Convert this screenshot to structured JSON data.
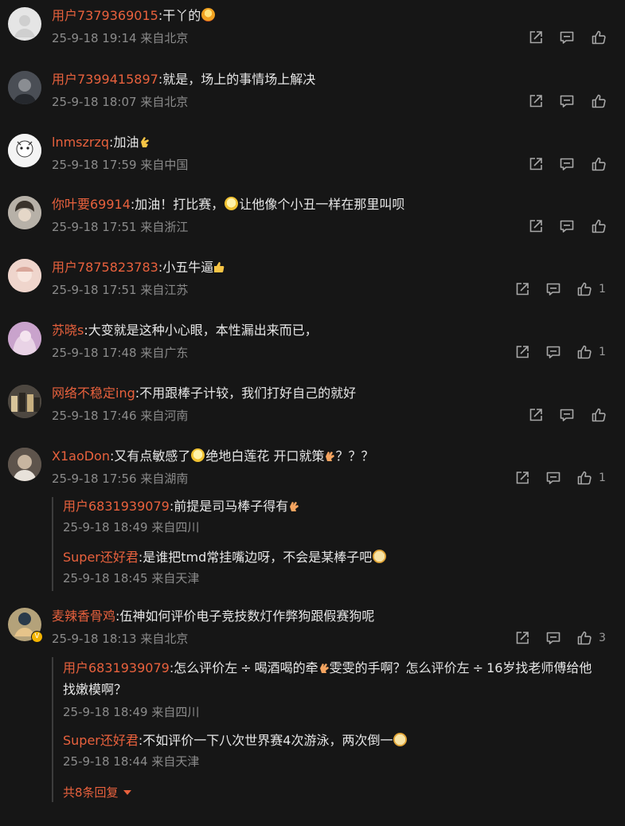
{
  "comments": [
    {
      "user": "用户7379369015",
      "text": ":干丫的",
      "emoji": "fire-face",
      "date": "25-9-18 19:14",
      "location": "来自北京",
      "likes": "",
      "avatar_color": "#e5e5e5"
    },
    {
      "user": "用户7399415897",
      "text": ":就是，场上的事情场上解决",
      "date": "25-9-18 18:07",
      "location": "来自北京",
      "likes": "",
      "avatar_color": "#5a6068"
    },
    {
      "user": "lnmszrzq",
      "text": ":加油",
      "emoji": "clap",
      "date": "25-9-18 17:59",
      "location": "来自中国",
      "likes": "",
      "avatar_color": "#f2f2f2"
    },
    {
      "user": "你叶要69914",
      "text_before": ":加油！打比赛，",
      "emoji": "laugh-cry",
      "text_after": "让他像个小丑一样在那里叫呗",
      "date": "25-9-18 17:51",
      "location": "来自浙江",
      "likes": "",
      "avatar_color": "#a8a29a"
    },
    {
      "user": "用户7875823783",
      "text": ":小五牛逼",
      "emoji": "thumbs-up",
      "date": "25-9-18 17:51",
      "location": "来自江苏",
      "likes": "1",
      "avatar_color": "#e8c8c0"
    },
    {
      "user": "苏晓s",
      "text": ":大变就是这种小心眼，本性漏出来而已，",
      "date": "25-9-18 17:48",
      "location": "来自广东",
      "likes": "1",
      "avatar_color": "#c59ac8"
    },
    {
      "user": "网络不稳定ing",
      "text": ":不用跟棒子计较，我们打好自己的就好",
      "date": "25-9-18 17:46",
      "location": "来自河南",
      "likes": "",
      "avatar_color": "#6b6458"
    },
    {
      "user": "X1aoDon",
      "text_before": ":又有点敏感了",
      "emoji": "laugh-cry",
      "text_mid": "绝地白莲花 开口就策",
      "emoji2": "prosthetic-hand",
      "text_after": "？？？",
      "date": "25-9-18 17:56",
      "location": "来自湖南",
      "likes": "1",
      "avatar_color": "#7a6f66",
      "replies": [
        {
          "user": "用户6831939079",
          "text": ":前提是司马棒子得有",
          "emoji": "prosthetic-hand",
          "date": "25-9-18 18:49",
          "location": "来自四川"
        },
        {
          "user": "Super还好君",
          "text": ":是谁把tmd常挂嘴边呀，不会是某棒子吧",
          "emoji": "cat-face",
          "date": "25-9-18 18:45",
          "location": "来自天津"
        }
      ]
    },
    {
      "user": "麦辣香骨鸡",
      "text": ":伍神如何评价电子竞技数灯作弊狗跟假赛狗呢",
      "date": "25-9-18 18:13",
      "location": "来自北京",
      "likes": "3",
      "avatar_color": "#8a7a5a",
      "verified_badge": "V",
      "replies": [
        {
          "user": "用户6831939079",
          "text_a": ":怎么评价左",
          "sym1": "÷",
          "text_b": "喝酒喝的牵",
          "text_c": "雯雯的手啊？怎么评价左",
          "sym2": "÷",
          "text_d": "16岁找老师傅给他",
          "text_line2": "找嫩模啊？",
          "date": "25-9-18 18:49",
          "location": "来自四川"
        },
        {
          "user": "Super还好君",
          "text": ":不如评价一下八次世界赛4次游泳，两次倒一",
          "emoji": "cat-face",
          "date": "25-9-18 18:44",
          "location": "来自天津"
        }
      ],
      "more_replies": "共8条回复"
    }
  ],
  "colors": {
    "background": "#161616",
    "username": "#e8613d",
    "text": "#e6e6e6",
    "meta": "#8b8b8b",
    "icon": "#a8a8a8"
  },
  "icons": [
    "share-icon",
    "comment-icon",
    "like-icon",
    "caret-down-icon"
  ]
}
